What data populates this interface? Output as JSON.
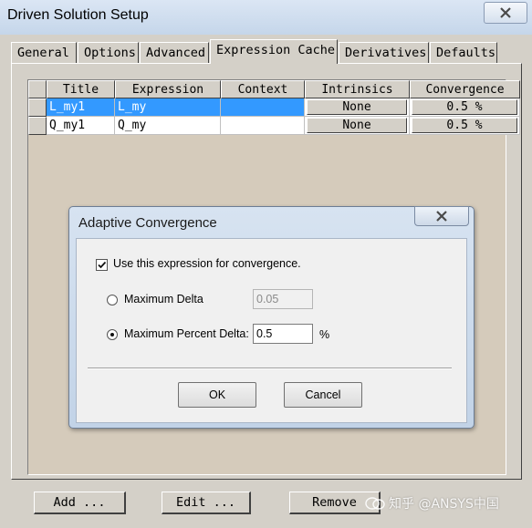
{
  "window": {
    "title": "Driven Solution Setup",
    "close_icon": "close-icon"
  },
  "tabs": [
    {
      "label": "General"
    },
    {
      "label": "Options"
    },
    {
      "label": "Advanced"
    },
    {
      "label": "Expression Cache",
      "active": true
    },
    {
      "label": "Derivatives"
    },
    {
      "label": "Defaults"
    }
  ],
  "grid": {
    "columns": [
      "Title",
      "Expression",
      "Context",
      "Intrinsics",
      "Convergence"
    ],
    "rows": [
      {
        "title": "L_my1",
        "expression": "L_my",
        "context": "",
        "intrinsics": "None",
        "convergence": "0.5 %",
        "selected": true
      },
      {
        "title": "Q_my1",
        "expression": "Q_my",
        "context": "",
        "intrinsics": "None",
        "convergence": "0.5 %",
        "selected": false
      }
    ]
  },
  "buttons": {
    "add": "Add ...",
    "edit": "Edit ...",
    "remove": "Remove"
  },
  "dialog": {
    "title": "Adaptive Convergence",
    "use_expression_label": "Use this expression for convergence.",
    "use_expression_checked": true,
    "max_delta_label": "Maximum Delta",
    "max_delta_value": "0.05",
    "max_percent_delta_label": "Maximum Percent Delta:",
    "max_percent_delta_value": "0.5",
    "percent_unit": "%",
    "selected_option": "max_percent_delta",
    "ok_label": "OK",
    "cancel_label": "Cancel"
  },
  "watermark": {
    "text": "知乎 @ANSYS中国"
  },
  "colors": {
    "selection": "#3399ff",
    "grid_background": "#d5cbbb",
    "face": "#d4d0c8"
  }
}
